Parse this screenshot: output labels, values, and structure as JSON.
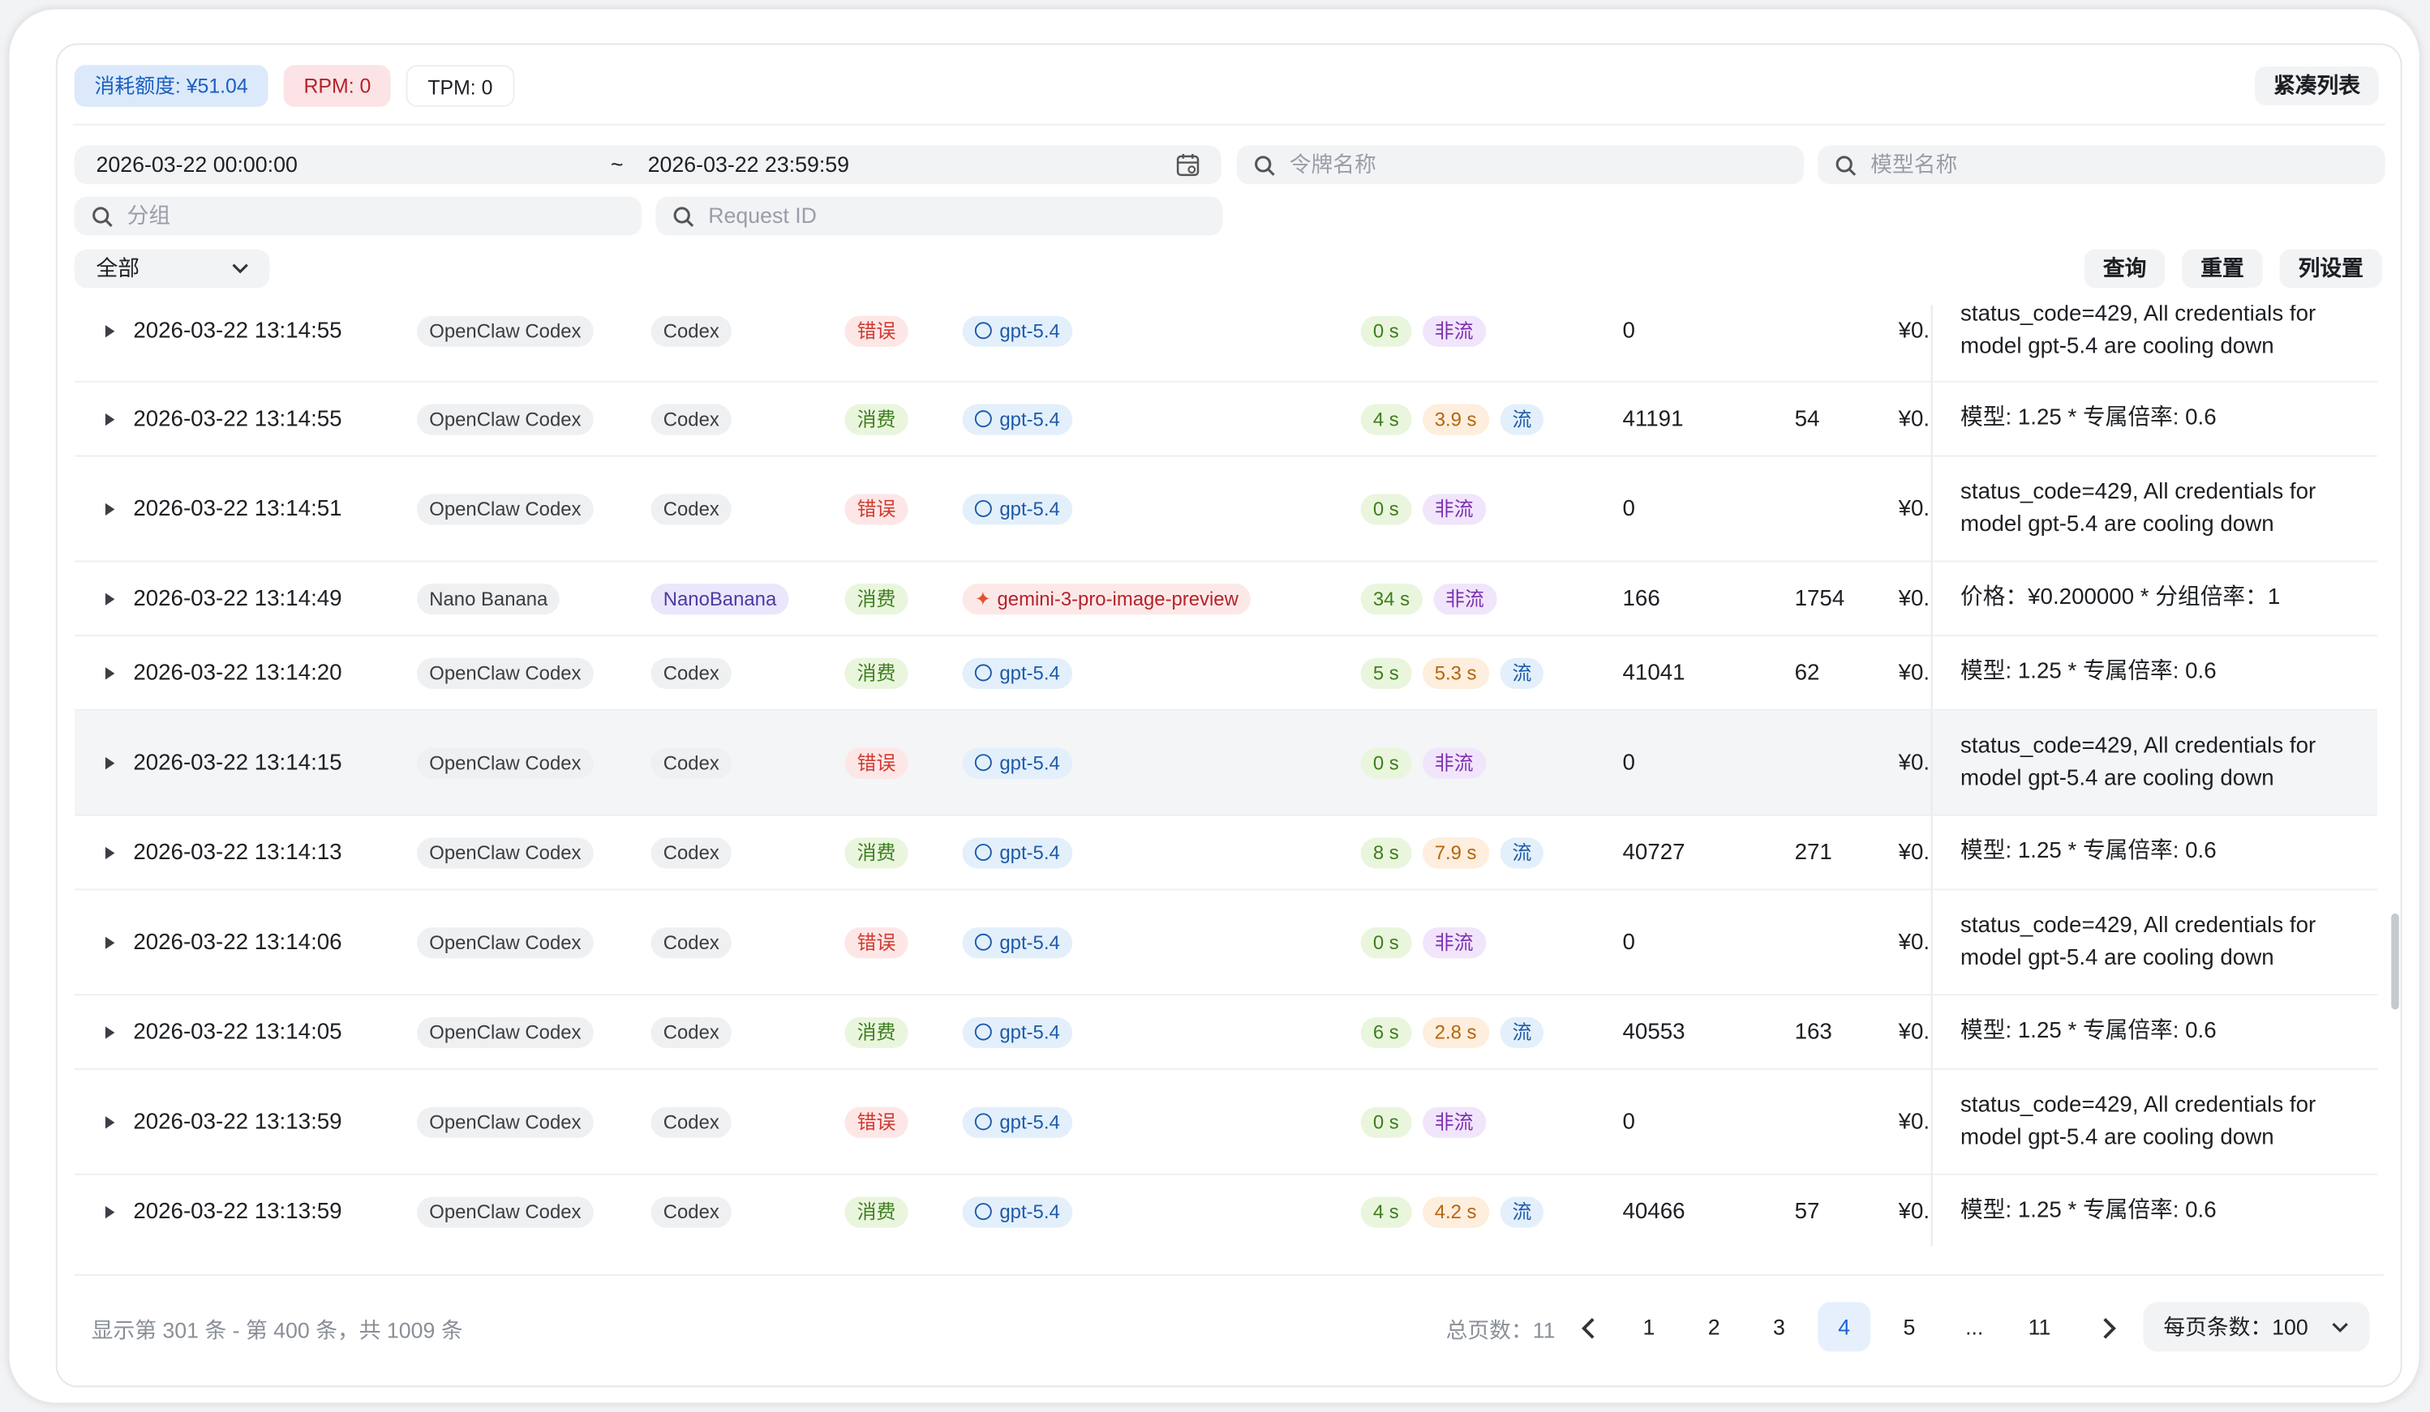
{
  "stats": {
    "quota": "消耗额度: ¥51.04",
    "rpm": "RPM: 0",
    "tpm": "TPM: 0"
  },
  "compact_btn": "紧凑列表",
  "filters": {
    "start": "2026-03-22 00:00:00",
    "tilde": "~",
    "end": "2026-03-22 23:59:59",
    "token_ph": "令牌名称",
    "model_ph": "模型名称",
    "group_ph": "分组",
    "request_ph": "Request ID",
    "type_value": "全部"
  },
  "actions": {
    "query": "查询",
    "reset": "重置",
    "columns": "列设置"
  },
  "rows": [
    {
      "time": "2026-03-22 13:14:55",
      "token": "OpenClaw Codex",
      "group": "Codex",
      "type": "错误",
      "model": "gpt-5.4",
      "t1": "0 s",
      "t2": "",
      "stream": "非流",
      "input": "0",
      "output": "",
      "cost": "¥0.",
      "l1": "status_code=429, All credentials for",
      "l2": "model gpt-5.4 are cooling down"
    },
    {
      "time": "2026-03-22 13:14:55",
      "token": "OpenClaw Codex",
      "group": "Codex",
      "type": "消费",
      "model": "gpt-5.4",
      "t1": "4 s",
      "t2": "3.9 s",
      "stream": "流",
      "input": "41191",
      "output": "54",
      "cost": "¥0.",
      "l1": "模型: 1.25 * 专属倍率: 0.6",
      "l2": ""
    },
    {
      "time": "2026-03-22 13:14:51",
      "token": "OpenClaw Codex",
      "group": "Codex",
      "type": "错误",
      "model": "gpt-5.4",
      "t1": "0 s",
      "t2": "",
      "stream": "非流",
      "input": "0",
      "output": "",
      "cost": "¥0.",
      "l1": "status_code=429, All credentials for",
      "l2": "model gpt-5.4 are cooling down"
    },
    {
      "time": "2026-03-22 13:14:49",
      "token": "Nano Banana",
      "group": "NanoBanana",
      "type": "消费",
      "model": "gemini-3-pro-image-preview",
      "t1": "34 s",
      "t2": "",
      "stream": "非流",
      "input": "166",
      "output": "1754",
      "cost": "¥0.",
      "l1": "价格：¥0.200000 * 分组倍率：1",
      "l2": ""
    },
    {
      "time": "2026-03-22 13:14:20",
      "token": "OpenClaw Codex",
      "group": "Codex",
      "type": "消费",
      "model": "gpt-5.4",
      "t1": "5 s",
      "t2": "5.3 s",
      "stream": "流",
      "input": "41041",
      "output": "62",
      "cost": "¥0.",
      "l1": "模型: 1.25 * 专属倍率: 0.6",
      "l2": ""
    },
    {
      "time": "2026-03-22 13:14:15",
      "token": "OpenClaw Codex",
      "group": "Codex",
      "type": "错误",
      "model": "gpt-5.4",
      "t1": "0 s",
      "t2": "",
      "stream": "非流",
      "input": "0",
      "output": "",
      "cost": "¥0.",
      "l1": "status_code=429, All credentials for",
      "l2": "model gpt-5.4 are cooling down"
    },
    {
      "time": "2026-03-22 13:14:13",
      "token": "OpenClaw Codex",
      "group": "Codex",
      "type": "消费",
      "model": "gpt-5.4",
      "t1": "8 s",
      "t2": "7.9 s",
      "stream": "流",
      "input": "40727",
      "output": "271",
      "cost": "¥0.",
      "l1": "模型: 1.25 * 专属倍率: 0.6",
      "l2": ""
    },
    {
      "time": "2026-03-22 13:14:06",
      "token": "OpenClaw Codex",
      "group": "Codex",
      "type": "错误",
      "model": "gpt-5.4",
      "t1": "0 s",
      "t2": "",
      "stream": "非流",
      "input": "0",
      "output": "",
      "cost": "¥0.",
      "l1": "status_code=429, All credentials for",
      "l2": "model gpt-5.4 are cooling down"
    },
    {
      "time": "2026-03-22 13:14:05",
      "token": "OpenClaw Codex",
      "group": "Codex",
      "type": "消费",
      "model": "gpt-5.4",
      "t1": "6 s",
      "t2": "2.8 s",
      "stream": "流",
      "input": "40553",
      "output": "163",
      "cost": "¥0.",
      "l1": "模型: 1.25 * 专属倍率: 0.6",
      "l2": ""
    },
    {
      "time": "2026-03-22 13:13:59",
      "token": "OpenClaw Codex",
      "group": "Codex",
      "type": "错误",
      "model": "gpt-5.4",
      "t1": "0 s",
      "t2": "",
      "stream": "非流",
      "input": "0",
      "output": "",
      "cost": "¥0.",
      "l1": "status_code=429, All credentials for",
      "l2": "model gpt-5.4 are cooling down"
    },
    {
      "time": "2026-03-22 13:13:59",
      "token": "OpenClaw Codex",
      "group": "Codex",
      "type": "消费",
      "model": "gpt-5.4",
      "t1": "4 s",
      "t2": "4.2 s",
      "stream": "流",
      "input": "40466",
      "output": "57",
      "cost": "¥0.",
      "l1": "模型: 1.25 * 专属倍率: 0.6",
      "l2": ""
    }
  ],
  "footer": {
    "range": "显示第 301 条 - 第 400 条，共 1009 条",
    "total": "总页数：11",
    "pages": [
      "1",
      "2",
      "3",
      "4",
      "5",
      "...",
      "11"
    ],
    "current": "4",
    "per_page": "每页条数：100"
  }
}
